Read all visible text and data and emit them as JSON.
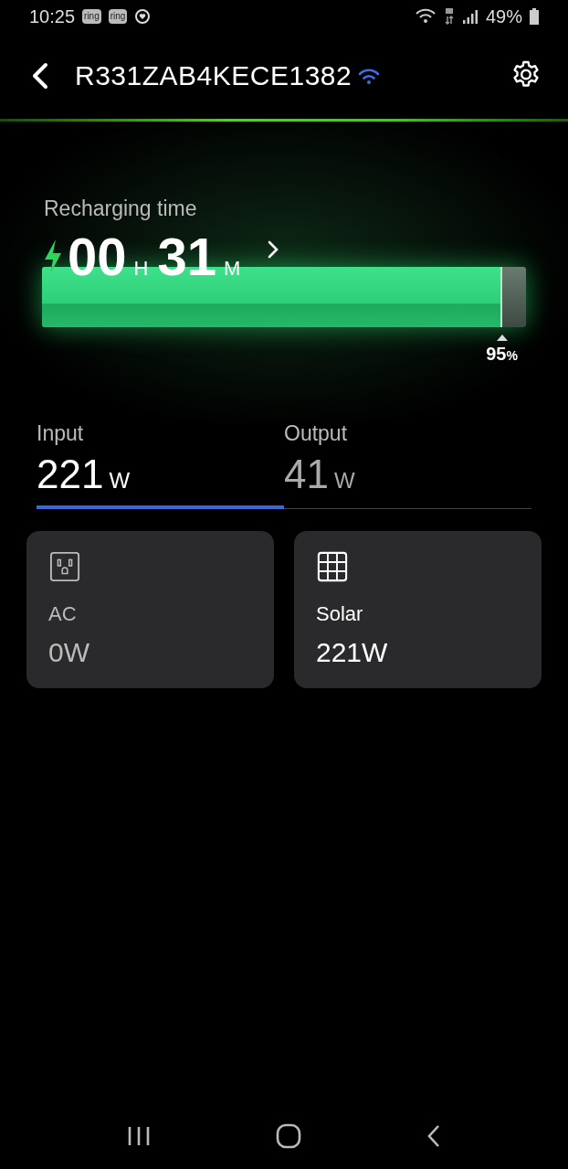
{
  "status_bar": {
    "time": "10:25",
    "notifications": [
      {
        "kind": "app",
        "label": "ring"
      },
      {
        "kind": "app",
        "label": "ring"
      },
      {
        "kind": "heart"
      }
    ],
    "battery": "49%"
  },
  "header": {
    "title": "R331ZAB4KECE1382",
    "connected": true
  },
  "recharge": {
    "label": "Recharging time",
    "hours": "00",
    "hours_unit": "H",
    "minutes": "31",
    "minutes_unit": "M",
    "level": 0.95,
    "percent": "95",
    "percent_unit": "%"
  },
  "tabs": [
    {
      "label": "Input",
      "value": "221",
      "unit": "W",
      "selected": true
    },
    {
      "label": "Output",
      "value": "41",
      "unit": "W",
      "selected": false
    }
  ],
  "sources": [
    {
      "kind": "ac",
      "label": "AC",
      "value": "0W",
      "active": false
    },
    {
      "kind": "solar",
      "label": "Solar",
      "value": "221W",
      "active": true
    }
  ]
}
